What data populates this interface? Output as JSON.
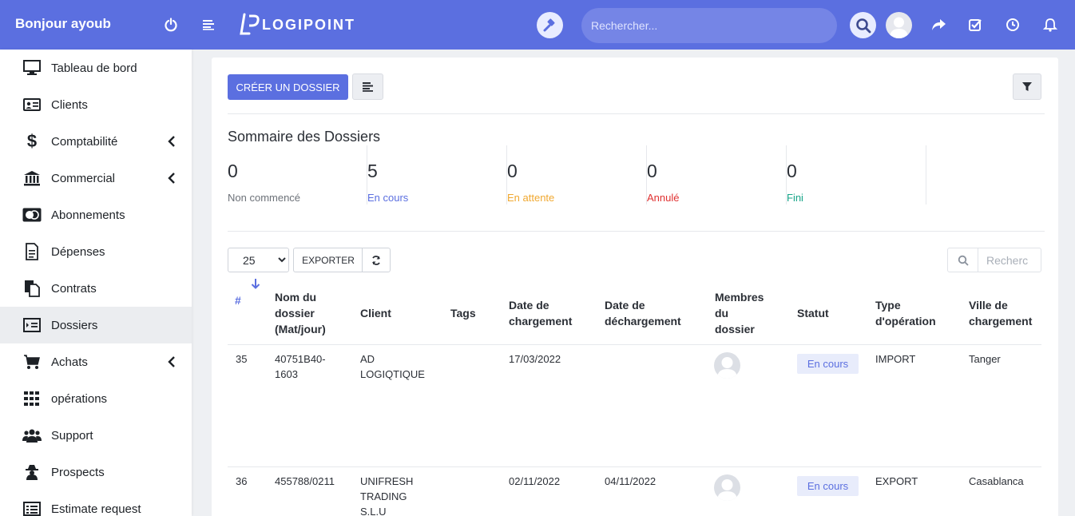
{
  "header": {
    "greeting": "Bonjour ayoub",
    "logo_text": "LOGIPOINT",
    "search_placeholder": "Rechercher...",
    "icons": [
      "power-icon",
      "menu-icon",
      "gavel-icon",
      "search-icon",
      "avatar",
      "share-icon",
      "checkbox-icon",
      "clock-icon",
      "bell-icon"
    ]
  },
  "sidebar": {
    "items": [
      {
        "label": "Tableau de bord",
        "icon": "monitor-icon",
        "has_children": false
      },
      {
        "label": "Clients",
        "icon": "id-card-icon",
        "has_children": false
      },
      {
        "label": "Comptabilité",
        "icon": "dollar-icon",
        "has_children": true
      },
      {
        "label": "Commercial",
        "icon": "bank-icon",
        "has_children": true
      },
      {
        "label": "Abonnements",
        "icon": "mastercard-icon",
        "has_children": false
      },
      {
        "label": "Dépenses",
        "icon": "document-icon",
        "has_children": false
      },
      {
        "label": "Contrats",
        "icon": "files-icon",
        "has_children": false
      },
      {
        "label": "Dossiers",
        "icon": "indent-icon",
        "has_children": false,
        "active": true
      },
      {
        "label": "Achats",
        "icon": "cart-icon",
        "has_children": true
      },
      {
        "label": "opérations",
        "icon": "grid-icon",
        "has_children": false
      },
      {
        "label": "Support",
        "icon": "users-icon",
        "has_children": false
      },
      {
        "label": "Prospects",
        "icon": "spy-icon",
        "has_children": false
      },
      {
        "label": "Estimate request",
        "icon": "list-icon",
        "has_children": false
      }
    ]
  },
  "toolbar": {
    "create_label": "CRÉER UN DOSSIER"
  },
  "summary": {
    "title": "Sommaire des Dossiers",
    "stats": [
      {
        "value": "0",
        "label": "Non commencé",
        "color": "#6c7178"
      },
      {
        "value": "5",
        "label": "En cours",
        "color": "#5b6fe0"
      },
      {
        "value": "0",
        "label": "En attente",
        "color": "#f0a830"
      },
      {
        "value": "0",
        "label": "Annulé",
        "color": "#e03131"
      },
      {
        "value": "0",
        "label": "Fini",
        "color": "#17a589"
      }
    ]
  },
  "controls": {
    "page_size": "25",
    "export_label": "EXPORTER",
    "search_placeholder": "Recherc"
  },
  "table": {
    "headers": {
      "num": "#",
      "nom_l1": "Nom du",
      "nom_l2": "dossier",
      "nom_l3": "(Mat/jour)",
      "client": "Client",
      "tags": "Tags",
      "dc_l1": "Date de",
      "dc_l2": "chargement",
      "dd_l1": "Date de",
      "dd_l2": "déchargement",
      "mem_l1": "Membres",
      "mem_l2": "du",
      "mem_l3": "dossier",
      "statut": "Statut",
      "type_l1": "Type",
      "type_l2": "d'opération",
      "ville_l1": "Ville de",
      "ville_l2": "chargement"
    },
    "rows": [
      {
        "num": "35",
        "nom_l1": "40751B40-",
        "nom_l2": "1603",
        "client_l1": "AD",
        "client_l2": "LOGIQTIQUE",
        "client_l3": "",
        "date_charg": "17/03/2022",
        "date_decharg": "",
        "statut": "En cours",
        "type": "IMPORT",
        "ville": "Tanger"
      },
      {
        "num": "36",
        "nom_l1": "455788/0211",
        "nom_l2": "",
        "client_l1": "UNIFRESH",
        "client_l2": "TRADING",
        "client_l3": "S.L.U",
        "date_charg": "02/11/2022",
        "date_decharg": "04/11/2022",
        "statut": "En cours",
        "type": "EXPORT",
        "ville": "Casablanca"
      }
    ]
  }
}
